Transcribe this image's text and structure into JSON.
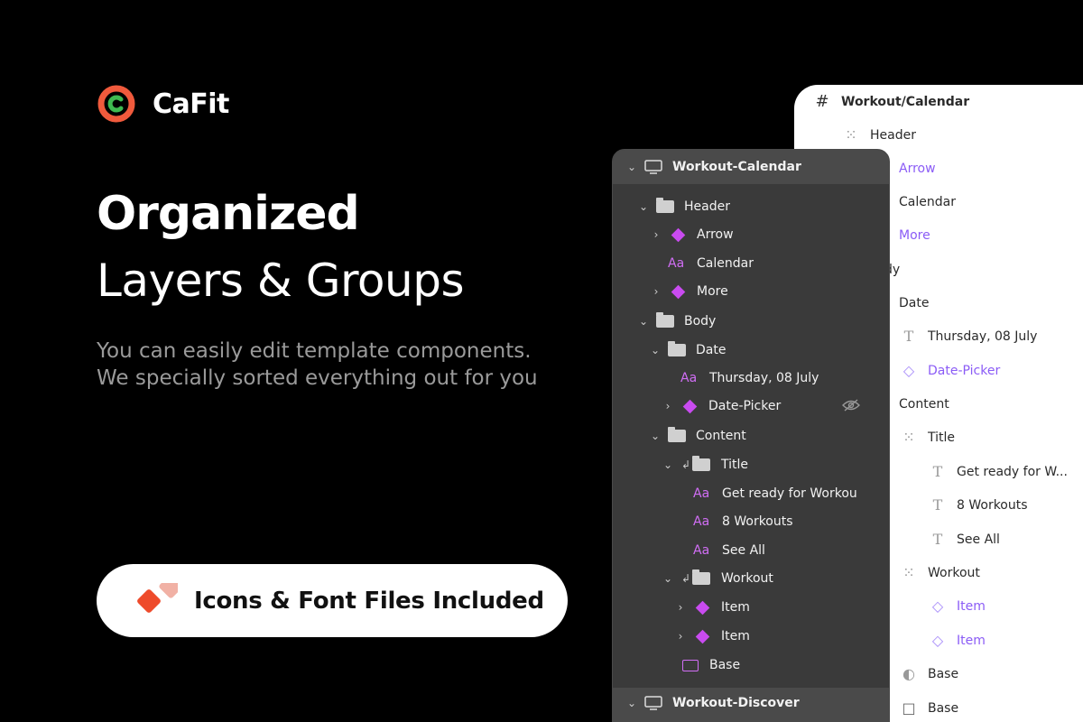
{
  "brand": {
    "name": "CaFit"
  },
  "hero": {
    "line1": "Organized",
    "line2": "Layers & Groups",
    "sub1": "You can easily edit template components.",
    "sub2": "We specially sorted everything out for you"
  },
  "pill": {
    "label": "Icons & Font Files Included"
  },
  "light_panel": {
    "title": "Workout/Calendar",
    "rows": [
      "Header",
      "Arrow",
      "Calendar",
      "More",
      "dy",
      "Date",
      "Thursday, 08 July",
      "Date-Picker",
      "Content",
      "Title",
      "Get ready for W...",
      "8 Workouts",
      "See All",
      "Workout",
      "Item",
      "Item",
      "Base",
      "Base"
    ]
  },
  "dark_panel": {
    "title": "Workout-Calendar",
    "footer_title": "Workout-Discover",
    "rows": [
      "Header",
      "Arrow",
      "Calendar",
      "More",
      "Body",
      "Date",
      "Thursday, 08 July",
      "Date-Picker",
      "Content",
      "Title",
      "Get ready for Workou",
      "8 Workouts",
      "See All",
      "Workout",
      "Item",
      "Item",
      "Base"
    ]
  },
  "colors": {
    "accent_purple": "#c94bf0",
    "logo_orange": "#f05a3c",
    "logo_green": "#3fb950"
  }
}
